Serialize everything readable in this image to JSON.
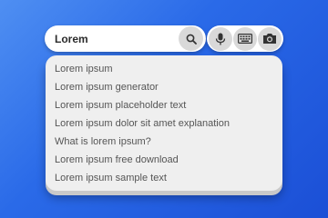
{
  "search": {
    "query": "Lorem",
    "search_icon": "search-icon"
  },
  "tools": [
    {
      "name": "microphone-icon"
    },
    {
      "name": "keyboard-icon"
    },
    {
      "name": "camera-icon"
    }
  ],
  "suggestions": [
    "Lorem ipsum",
    "Lorem ipsum generator",
    "Lorem ipsum placeholder text",
    "Lorem ipsum dolor sit amet explanation",
    "What is lorem ipsum?",
    "Lorem ipsum free download",
    "Lorem ipsum sample text"
  ],
  "colors": {
    "background_start": "#4f8ff2",
    "background_end": "#1b4fd6",
    "button_bg": "#d9d9d9",
    "dropdown_bg": "#efefef"
  }
}
